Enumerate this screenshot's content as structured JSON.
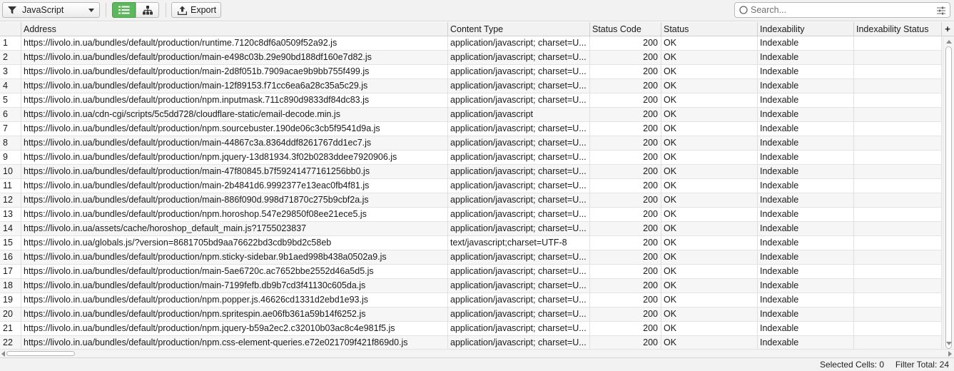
{
  "toolbar": {
    "filter_value": "JavaScript",
    "export_label": "Export",
    "search_placeholder": "Search...",
    "list_view_color": "#5cb85c"
  },
  "icons": [
    "funnel-icon",
    "chevron-down-icon",
    "list-view-icon",
    "tree-view-icon",
    "export-icon",
    "search-icon",
    "search-options-icon",
    "add-column-icon"
  ],
  "table": {
    "columns": [
      "",
      "Address",
      "Content Type",
      "Status Code",
      "Status",
      "Indexability",
      "Indexability Status"
    ],
    "add_column_label": "+",
    "rows": [
      {
        "n": "1",
        "address": "https://livolo.in.ua/bundles/default/production/runtime.7120c8df6a0509f52a92.js",
        "content_type": "application/javascript; charset=U...",
        "status_code": "200",
        "status": "OK",
        "indexability": "Indexable",
        "indexability_status": ""
      },
      {
        "n": "2",
        "address": "https://livolo.in.ua/bundles/default/production/main-e498c03b.29e90bd188df160e7d82.js",
        "content_type": "application/javascript; charset=U...",
        "status_code": "200",
        "status": "OK",
        "indexability": "Indexable",
        "indexability_status": ""
      },
      {
        "n": "3",
        "address": "https://livolo.in.ua/bundles/default/production/main-2d8f051b.7909acae9b9bb755f499.js",
        "content_type": "application/javascript; charset=U...",
        "status_code": "200",
        "status": "OK",
        "indexability": "Indexable",
        "indexability_status": ""
      },
      {
        "n": "4",
        "address": "https://livolo.in.ua/bundles/default/production/main-12f89153.f71cc6ea6a28c35a5c29.js",
        "content_type": "application/javascript; charset=U...",
        "status_code": "200",
        "status": "OK",
        "indexability": "Indexable",
        "indexability_status": ""
      },
      {
        "n": "5",
        "address": "https://livolo.in.ua/bundles/default/production/npm.inputmask.711c890d9833df84dc83.js",
        "content_type": "application/javascript; charset=U...",
        "status_code": "200",
        "status": "OK",
        "indexability": "Indexable",
        "indexability_status": ""
      },
      {
        "n": "6",
        "address": "https://livolo.in.ua/cdn-cgi/scripts/5c5dd728/cloudflare-static/email-decode.min.js",
        "content_type": "application/javascript",
        "status_code": "200",
        "status": "OK",
        "indexability": "Indexable",
        "indexability_status": ""
      },
      {
        "n": "7",
        "address": "https://livolo.in.ua/bundles/default/production/npm.sourcebuster.190de06c3cb5f9541d9a.js",
        "content_type": "application/javascript; charset=U...",
        "status_code": "200",
        "status": "OK",
        "indexability": "Indexable",
        "indexability_status": ""
      },
      {
        "n": "8",
        "address": "https://livolo.in.ua/bundles/default/production/main-44867c3a.8364ddf8261767dd1ec7.js",
        "content_type": "application/javascript; charset=U...",
        "status_code": "200",
        "status": "OK",
        "indexability": "Indexable",
        "indexability_status": ""
      },
      {
        "n": "9",
        "address": "https://livolo.in.ua/bundles/default/production/npm.jquery-13d81934.3f02b0283ddee7920906.js",
        "content_type": "application/javascript; charset=U...",
        "status_code": "200",
        "status": "OK",
        "indexability": "Indexable",
        "indexability_status": ""
      },
      {
        "n": "10",
        "address": "https://livolo.in.ua/bundles/default/production/main-47f80845.b7f59241477161256bb0.js",
        "content_type": "application/javascript; charset=U...",
        "status_code": "200",
        "status": "OK",
        "indexability": "Indexable",
        "indexability_status": ""
      },
      {
        "n": "11",
        "address": "https://livolo.in.ua/bundles/default/production/main-2b4841d6.9992377e13eac0fb4f81.js",
        "content_type": "application/javascript; charset=U...",
        "status_code": "200",
        "status": "OK",
        "indexability": "Indexable",
        "indexability_status": ""
      },
      {
        "n": "12",
        "address": "https://livolo.in.ua/bundles/default/production/main-886f090d.998d71870c275b9cbf2a.js",
        "content_type": "application/javascript; charset=U...",
        "status_code": "200",
        "status": "OK",
        "indexability": "Indexable",
        "indexability_status": ""
      },
      {
        "n": "13",
        "address": "https://livolo.in.ua/bundles/default/production/npm.horoshop.547e29850f08ee21ece5.js",
        "content_type": "application/javascript; charset=U...",
        "status_code": "200",
        "status": "OK",
        "indexability": "Indexable",
        "indexability_status": ""
      },
      {
        "n": "14",
        "address": "https://livolo.in.ua/assets/cache/horoshop_default_main.js?1755023837",
        "content_type": "application/javascript; charset=U...",
        "status_code": "200",
        "status": "OK",
        "indexability": "Indexable",
        "indexability_status": ""
      },
      {
        "n": "15",
        "address": "https://livolo.in.ua/globals.js/?version=8681705bd9aa76622bd3cdb9bd2c58eb",
        "content_type": "text/javascript;charset=UTF-8",
        "status_code": "200",
        "status": "OK",
        "indexability": "Indexable",
        "indexability_status": ""
      },
      {
        "n": "16",
        "address": "https://livolo.in.ua/bundles/default/production/npm.sticky-sidebar.9b1aed998b438a0502a9.js",
        "content_type": "application/javascript; charset=U...",
        "status_code": "200",
        "status": "OK",
        "indexability": "Indexable",
        "indexability_status": ""
      },
      {
        "n": "17",
        "address": "https://livolo.in.ua/bundles/default/production/main-5ae6720c.ac7652bbe2552d46a5d5.js",
        "content_type": "application/javascript; charset=U...",
        "status_code": "200",
        "status": "OK",
        "indexability": "Indexable",
        "indexability_status": ""
      },
      {
        "n": "18",
        "address": "https://livolo.in.ua/bundles/default/production/main-7199fefb.db9b7cd3f41130c605da.js",
        "content_type": "application/javascript; charset=U...",
        "status_code": "200",
        "status": "OK",
        "indexability": "Indexable",
        "indexability_status": ""
      },
      {
        "n": "19",
        "address": "https://livolo.in.ua/bundles/default/production/npm.popper.js.46626cd1331d2ebd1e93.js",
        "content_type": "application/javascript; charset=U...",
        "status_code": "200",
        "status": "OK",
        "indexability": "Indexable",
        "indexability_status": ""
      },
      {
        "n": "20",
        "address": "https://livolo.in.ua/bundles/default/production/npm.spritespin.ae06fb361a59b14f6252.js",
        "content_type": "application/javascript; charset=U...",
        "status_code": "200",
        "status": "OK",
        "indexability": "Indexable",
        "indexability_status": ""
      },
      {
        "n": "21",
        "address": "https://livolo.in.ua/bundles/default/production/npm.jquery-b59a2ec2.c32010b03ac8c4e981f5.js",
        "content_type": "application/javascript; charset=U...",
        "status_code": "200",
        "status": "OK",
        "indexability": "Indexable",
        "indexability_status": ""
      },
      {
        "n": "22",
        "address": "https://livolo.in.ua/bundles/default/production/npm.css-element-queries.e72e021709f421f869d0.js",
        "content_type": "application/javascript; charset=U...",
        "status_code": "200",
        "status": "OK",
        "indexability": "Indexable",
        "indexability_status": ""
      }
    ]
  },
  "status_bar": {
    "selected_cells": "Selected Cells:  0",
    "filter_total": "Filter Total:  24"
  }
}
